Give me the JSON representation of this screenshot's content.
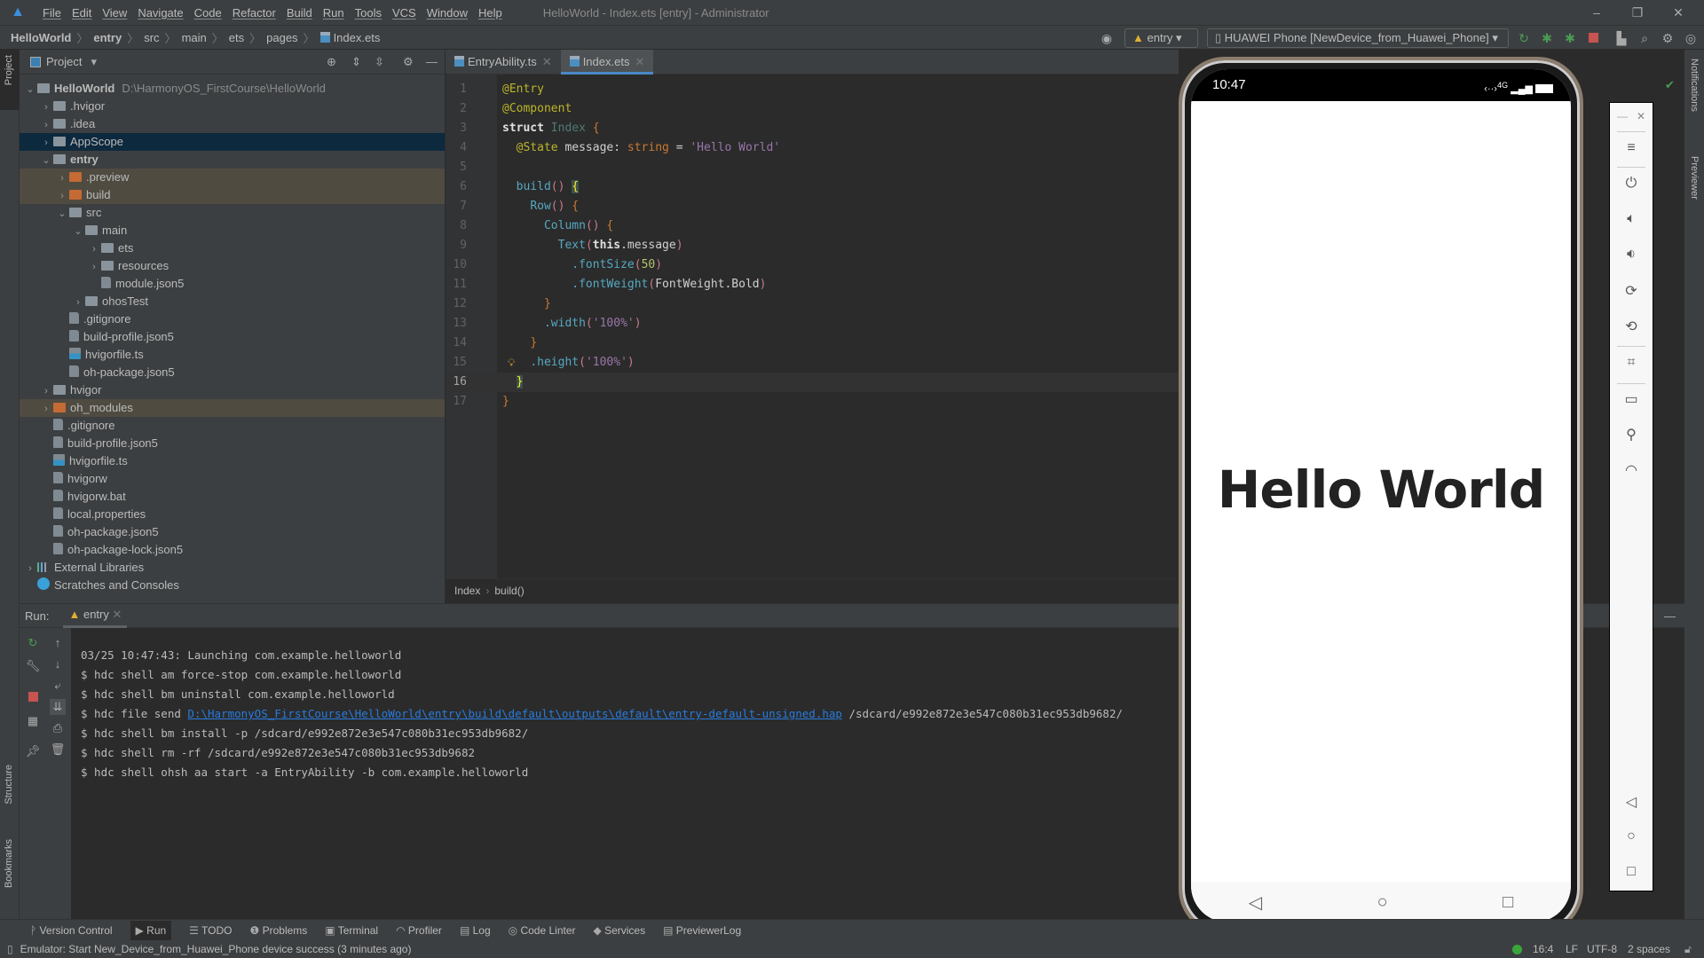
{
  "menubar": {
    "items": [
      "File",
      "Edit",
      "View",
      "Navigate",
      "Code",
      "Refactor",
      "Build",
      "Run",
      "Tools",
      "VCS",
      "Window",
      "Help"
    ],
    "window_title": "HelloWorld - Index.ets [entry] - Administrator"
  },
  "breadcrumb": [
    "HelloWorld",
    "entry",
    "src",
    "main",
    "ets",
    "pages",
    "Index.ets"
  ],
  "toolbar": {
    "run_config": "entry",
    "device": "HUAWEI Phone [NewDevice_from_Huawei_Phone]"
  },
  "left_strip": {
    "project": "Project",
    "structure": "Structure",
    "bookmarks": "Bookmarks"
  },
  "right_strip": {
    "notifications": "Notifications",
    "previewer": "Previewer"
  },
  "project": {
    "title": "Project",
    "tree": [
      {
        "label": "HelloWorld",
        "hint": "D:\\HarmonyOS_FirstCourse\\HelloWorld",
        "depth": 0,
        "arrow": "open",
        "icon": "module",
        "bold": true
      },
      {
        "label": ".hvigor",
        "depth": 1,
        "arrow": "closed",
        "icon": "folder"
      },
      {
        "label": ".idea",
        "depth": 1,
        "arrow": "closed",
        "icon": "folder"
      },
      {
        "label": "AppScope",
        "depth": 1,
        "arrow": "closed",
        "icon": "folder",
        "state": "sel"
      },
      {
        "label": "entry",
        "depth": 1,
        "arrow": "open",
        "icon": "module",
        "bold": true
      },
      {
        "label": ".preview",
        "depth": 2,
        "arrow": "closed",
        "icon": "orange",
        "state": "ex"
      },
      {
        "label": "build",
        "depth": 2,
        "arrow": "closed",
        "icon": "orange",
        "state": "ex"
      },
      {
        "label": "src",
        "depth": 2,
        "arrow": "open",
        "icon": "folder"
      },
      {
        "label": "main",
        "depth": 3,
        "arrow": "open",
        "icon": "folder"
      },
      {
        "label": "ets",
        "depth": 4,
        "arrow": "closed",
        "icon": "folder"
      },
      {
        "label": "resources",
        "depth": 4,
        "arrow": "closed",
        "icon": "folder"
      },
      {
        "label": "module.json5",
        "depth": 4,
        "arrow": "none",
        "icon": "file"
      },
      {
        "label": "ohosTest",
        "depth": 3,
        "arrow": "closed",
        "icon": "folder"
      },
      {
        "label": ".gitignore",
        "depth": 2,
        "arrow": "none",
        "icon": "file"
      },
      {
        "label": "build-profile.json5",
        "depth": 2,
        "arrow": "none",
        "icon": "file"
      },
      {
        "label": "hvigorfile.ts",
        "depth": 2,
        "arrow": "none",
        "icon": "ts"
      },
      {
        "label": "oh-package.json5",
        "depth": 2,
        "arrow": "none",
        "icon": "file"
      },
      {
        "label": "hvigor",
        "depth": 1,
        "arrow": "closed",
        "icon": "folder"
      },
      {
        "label": "oh_modules",
        "depth": 1,
        "arrow": "closed",
        "icon": "orange",
        "state": "ex"
      },
      {
        "label": ".gitignore",
        "depth": 1,
        "arrow": "none",
        "icon": "file"
      },
      {
        "label": "build-profile.json5",
        "depth": 1,
        "arrow": "none",
        "icon": "file"
      },
      {
        "label": "hvigorfile.ts",
        "depth": 1,
        "arrow": "none",
        "icon": "ts"
      },
      {
        "label": "hvigorw",
        "depth": 1,
        "arrow": "none",
        "icon": "file"
      },
      {
        "label": "hvigorw.bat",
        "depth": 1,
        "arrow": "none",
        "icon": "file"
      },
      {
        "label": "local.properties",
        "depth": 1,
        "arrow": "none",
        "icon": "file"
      },
      {
        "label": "oh-package.json5",
        "depth": 1,
        "arrow": "none",
        "icon": "file"
      },
      {
        "label": "oh-package-lock.json5",
        "depth": 1,
        "arrow": "none",
        "icon": "file"
      },
      {
        "label": "External Libraries",
        "depth": 0,
        "arrow": "closed",
        "icon": "lib"
      },
      {
        "label": "Scratches and Consoles",
        "depth": 0,
        "arrow": "none",
        "icon": "scratch"
      }
    ]
  },
  "editor": {
    "tabs": [
      {
        "label": "EntryAbility.ts",
        "active": false
      },
      {
        "label": "Index.ets",
        "active": true
      }
    ],
    "current_line": 16,
    "lines": [
      [
        [
          "@Entry",
          "ann"
        ]
      ],
      [
        [
          "@Component",
          "ann"
        ]
      ],
      [
        [
          "struct ",
          "kwb"
        ],
        [
          "Index ",
          "cls"
        ],
        [
          "{",
          "br"
        ]
      ],
      [
        [
          "  ",
          " "
        ],
        [
          "@State ",
          "ann"
        ],
        [
          "message: ",
          "pl"
        ],
        [
          "string ",
          "kw"
        ],
        [
          "= ",
          "pl"
        ],
        [
          "'Hello World'",
          "strp"
        ]
      ],
      [],
      [
        [
          "  ",
          " "
        ],
        [
          "build",
          "fn"
        ],
        [
          "() ",
          "par"
        ],
        [
          "{",
          "hl"
        ]
      ],
      [
        [
          "    ",
          " "
        ],
        [
          "Row",
          "fn"
        ],
        [
          "() ",
          "par"
        ],
        [
          "{",
          "br"
        ]
      ],
      [
        [
          "      ",
          " "
        ],
        [
          "Column",
          "fn"
        ],
        [
          "() ",
          "par"
        ],
        [
          "{",
          "br"
        ]
      ],
      [
        [
          "        ",
          " "
        ],
        [
          "Text",
          "fn"
        ],
        [
          "(",
          "par"
        ],
        [
          "this",
          "kwb"
        ],
        [
          ".message",
          "pl"
        ],
        [
          ")",
          "par"
        ]
      ],
      [
        [
          "          ",
          " "
        ],
        [
          ".fontSize",
          "fn"
        ],
        [
          "(",
          "par"
        ],
        [
          "50",
          "num"
        ],
        [
          ")",
          "par"
        ]
      ],
      [
        [
          "          ",
          " "
        ],
        [
          ".fontWeight",
          "fn"
        ],
        [
          "(",
          "par"
        ],
        [
          "FontWeight.Bold",
          "pl"
        ],
        [
          ")",
          "par"
        ]
      ],
      [
        [
          "      ",
          " "
        ],
        [
          "}",
          "br"
        ]
      ],
      [
        [
          "      ",
          " "
        ],
        [
          ".width",
          "fn"
        ],
        [
          "(",
          "par"
        ],
        [
          "'100%'",
          "strp"
        ],
        [
          ")",
          "par"
        ]
      ],
      [
        [
          "    ",
          " "
        ],
        [
          "}",
          "br"
        ]
      ],
      [
        [
          "    ",
          " "
        ],
        [
          ".height",
          "fn"
        ],
        [
          "(",
          "par"
        ],
        [
          "'100%'",
          "strp"
        ],
        [
          ")",
          "par"
        ]
      ],
      [
        [
          "  ",
          " "
        ],
        [
          "}",
          "hl"
        ]
      ],
      [
        [
          "}",
          "br"
        ]
      ]
    ],
    "breadcrumb": [
      "Index",
      "build()"
    ]
  },
  "run": {
    "label": "Run:",
    "tab": "entry",
    "lines": [
      {
        "text": "03/25 10:47:43: Launching com.example.helloworld"
      },
      {
        "text": "$ hdc shell am force-stop com.example.helloworld"
      },
      {
        "text": "$ hdc shell bm uninstall com.example.helloworld"
      },
      {
        "text": "$ hdc file send ",
        "link": "D:\\HarmonyOS_FirstCourse\\HelloWorld\\entry\\build\\default\\outputs\\default\\entry-default-unsigned.hap",
        "after": " /sdcard/e992e872e3e547c080b31ec953db9682/"
      },
      {
        "text": "$ hdc shell bm install -p /sdcard/e992e872e3e547c080b31ec953db9682/"
      },
      {
        "text": "$ hdc shell rm -rf /sdcard/e992e872e3e547c080b31ec953db9682"
      },
      {
        "text": "$ hdc shell ohsh aa start -a EntryAbility -b com.example.helloworld"
      }
    ]
  },
  "bottom_tools": [
    "Version Control",
    "Run",
    "TODO",
    "Problems",
    "Terminal",
    "Profiler",
    "Log",
    "Code Linter",
    "Services",
    "PreviewerLog"
  ],
  "status": {
    "message": "Emulator: Start New_Device_from_Huawei_Phone device success (3 minutes ago)",
    "position": "16:4",
    "line_sep": "LF",
    "encoding": "UTF-8",
    "indent": "2 spaces"
  },
  "phone": {
    "time": "10:47",
    "network": "4G",
    "content_text": "Hello World"
  }
}
